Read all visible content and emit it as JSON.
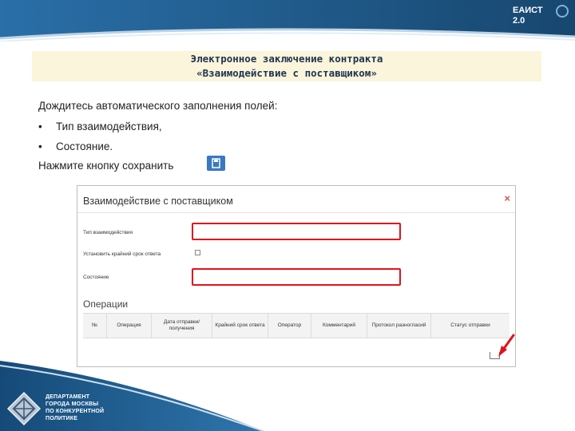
{
  "header": {
    "system_label": "ЕАИСТ 2.0"
  },
  "slide": {
    "title_line1": "Электронное заключение контракта",
    "title_line2": "«Взаимодействие с поставщиком»",
    "instruction": "Дождитесь автоматического заполнения полей:",
    "bullets": [
      "Тип взаимодействия,",
      "Состояние."
    ],
    "save_instruction": "Нажмите кнопку сохранить"
  },
  "dialog": {
    "title": "Взаимодействие с поставщиком",
    "close": "×",
    "fields": {
      "type_label": "Тип взаимодействия",
      "deadline_label": "Установить крайний срок ответа",
      "state_label": "Состояние"
    },
    "operations_title": "Операции",
    "table_headers": [
      "№",
      "Операция",
      "Дата отправки/ получения",
      "Крайний срок ответа",
      "Оператор",
      "Комментарий",
      "Протокол разногласий",
      "Статус отправки"
    ]
  },
  "footer": {
    "department": [
      "ДЕПАРТАМЕНТ",
      "ГОРОДА МОСКВЫ",
      "ПО КОНКУРЕНТНОЙ",
      "ПОЛИТИКЕ"
    ]
  },
  "colors": {
    "banner": "#1d5a8f",
    "highlight": "#e0131b",
    "save_button": "#3a78c2",
    "title_bg": "#faf5db"
  },
  "icons": {
    "save": "floppy-disk-icon",
    "close": "close-icon",
    "tray": "inbox-icon"
  }
}
